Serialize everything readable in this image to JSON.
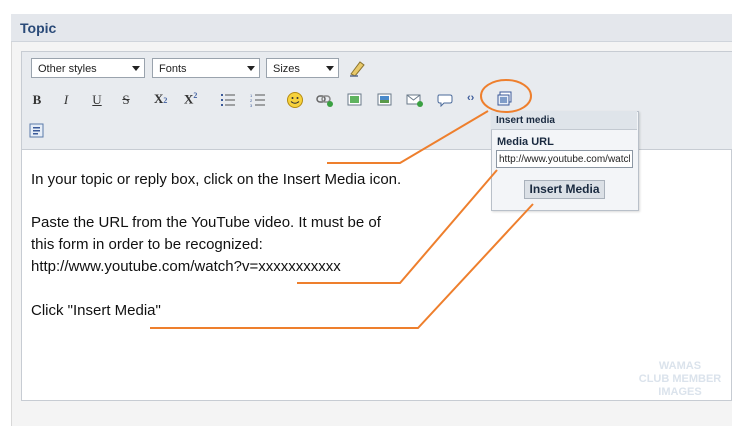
{
  "header": {
    "title": "Topic"
  },
  "toolbar": {
    "styles_select": "Other styles",
    "fonts_select": "Fonts",
    "sizes_select": "Sizes",
    "bold": "B",
    "italic": "I",
    "underline": "U",
    "strike": "S",
    "subscript": "X",
    "subscript_sub": "2",
    "superscript": "X",
    "superscript_sup": "2",
    "code_icon": "‹›"
  },
  "popup": {
    "title": "Insert media",
    "media_url_label": "Media URL",
    "media_url_value": "http://www.youtube.com/watch?v=",
    "insert_button": "Insert Media"
  },
  "instructions": {
    "line1": "In your topic or reply box, click on the Insert Media icon.",
    "line2": "Paste the URL from the YouTube video. It must be of",
    "line3": "this form in order to be recognized:",
    "line4": "http://www.youtube.com/watch?v=xxxxxxxxxxx",
    "line5": "Click \"Insert Media\""
  },
  "watermark": {
    "line1": "WAMAS",
    "line2": "CLUB MEMBER",
    "line3": "IMAGES"
  },
  "colors": {
    "accent": "#ee7f2d",
    "header_text": "#2a4a78"
  }
}
